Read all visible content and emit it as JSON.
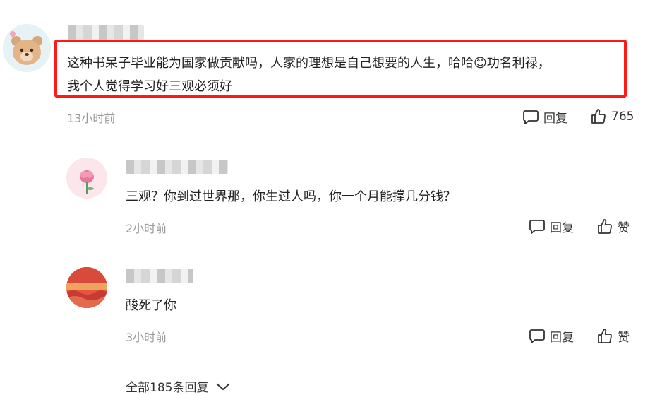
{
  "main_comment": {
    "text_line1": "这种书呆子毕业能为国家做贡献吗，人家的理想是自己想要的人生，哈哈😊功名利禄，",
    "text_line2": "我个人觉得学习好三观必须好",
    "time": "13小时前",
    "reply_label": "回复",
    "like_count": "765",
    "avatar_icon": "bear-avatar-icon"
  },
  "replies": [
    {
      "text": "三观？你到过世界那，你生过人吗，你一个月能撑几分钱？",
      "time": "2小时前",
      "reply_label": "回复",
      "like_label": "赞",
      "avatar_icon": "flower-avatar-icon"
    },
    {
      "text": "酸死了你",
      "time": "3小时前",
      "reply_label": "回复",
      "like_label": "赞",
      "avatar_icon": "sunset-avatar-icon"
    }
  ],
  "all_replies_label": "全部185条回复",
  "colors": {
    "highlight": "#ff1a1a",
    "time_gray": "#999999",
    "text": "#222222"
  }
}
